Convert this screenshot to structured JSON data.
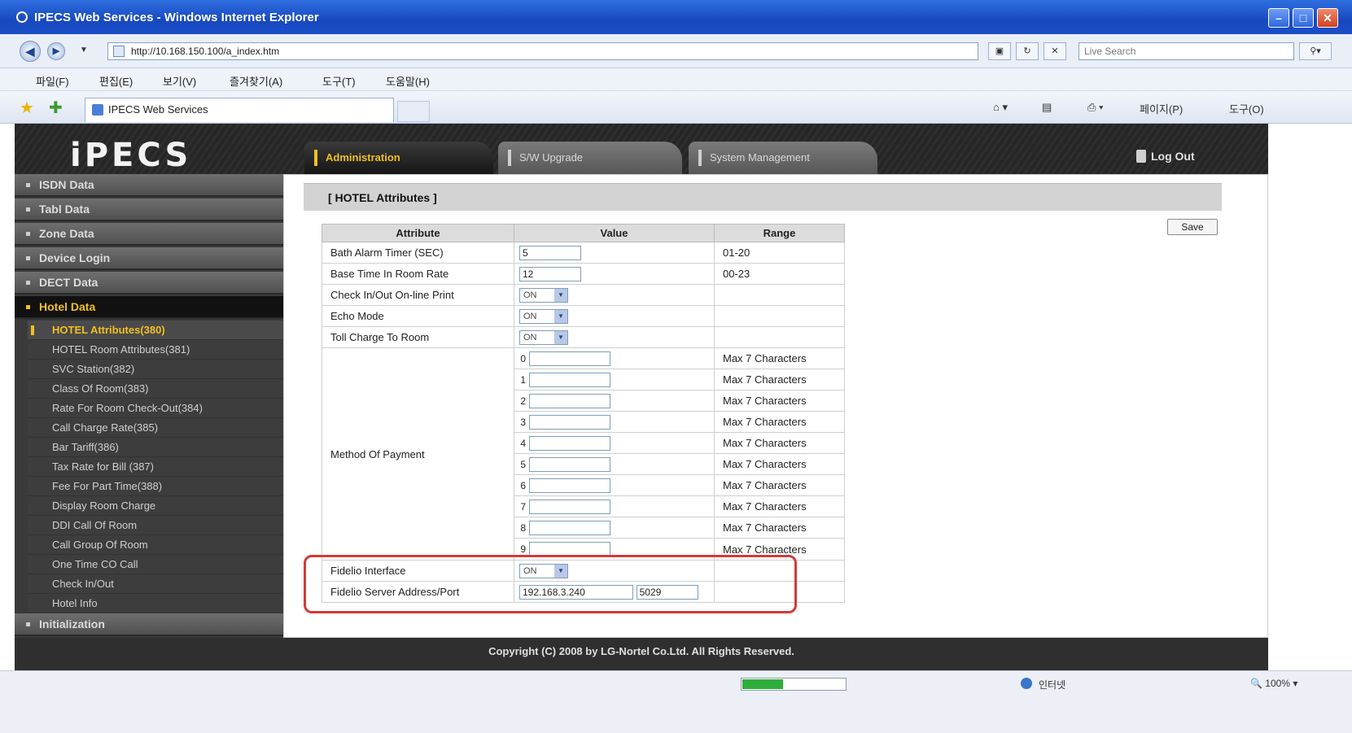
{
  "window": {
    "title": "IPECS Web Services - Windows Internet Explorer",
    "url": "http://10.168.150.100/a_index.htm",
    "search_placeholder": "Live Search",
    "tab_title": "IPECS Web Services"
  },
  "browser_menu": [
    "파일(F)",
    "편집(E)",
    "보기(V)",
    "즐겨찾기(A)",
    "도구(T)",
    "도움말(H)"
  ],
  "browser_commands": [
    "페이지(P)",
    "도구(O)"
  ],
  "app": {
    "logo": "iPECS",
    "tabs": [
      "Administration",
      "S/W Upgrade",
      "System Management"
    ],
    "logout": "Log Out",
    "sidebar": {
      "top_items": [
        "ISDN Data",
        "Tabl Data",
        "Zone Data",
        "Device Login",
        "DECT Data"
      ],
      "active_section": "Hotel Data",
      "sub_items": [
        "HOTEL Attributes(380)",
        "HOTEL Room Attributes(381)",
        "SVC Station(382)",
        "Class Of Room(383)",
        "Rate For Room Check-Out(384)",
        "Call Charge Rate(385)",
        "Bar Tariff(386)",
        "Tax Rate for Bill (387)",
        "Fee For Part Time(388)",
        "Display Room Charge",
        "DDI Call Of Room",
        "Call Group Of Room",
        "One Time CO Call",
        "Check In/Out",
        "Hotel Info"
      ],
      "bottom_item": "Initialization"
    },
    "content": {
      "title": "[ HOTEL Attributes ]",
      "save_label": "Save",
      "columns": [
        "Attribute",
        "Value",
        "Range"
      ],
      "rows": [
        {
          "attribute": "Bath Alarm Timer (SEC)",
          "value": "5",
          "range": "01-20"
        },
        {
          "attribute": "Base Time In Room Rate",
          "value": "12",
          "range": "00-23"
        },
        {
          "attribute": "Check In/Out On-line Print",
          "value": "ON"
        },
        {
          "attribute": "Echo Mode",
          "value": "ON"
        },
        {
          "attribute": "Toll Charge To Room",
          "value": "ON"
        }
      ],
      "payment": {
        "label": "Method Of Payment",
        "indices": [
          "0",
          "1",
          "2",
          "3",
          "4",
          "5",
          "6",
          "7",
          "8",
          "9"
        ],
        "range": "Max 7 Characters"
      },
      "fidelio": {
        "interface_label": "Fidelio Interface",
        "interface_value": "ON",
        "server_label": "Fidelio Server Address/Port",
        "server_ip": "192.168.3.240",
        "server_port": "5029"
      }
    },
    "footer": "Copyright (C) 2008 by LG-Nortel Co.Ltd. All Rights Reserved."
  },
  "status": {
    "progress_percent": 40,
    "zone": "인터넷",
    "zoom": "100%"
  }
}
